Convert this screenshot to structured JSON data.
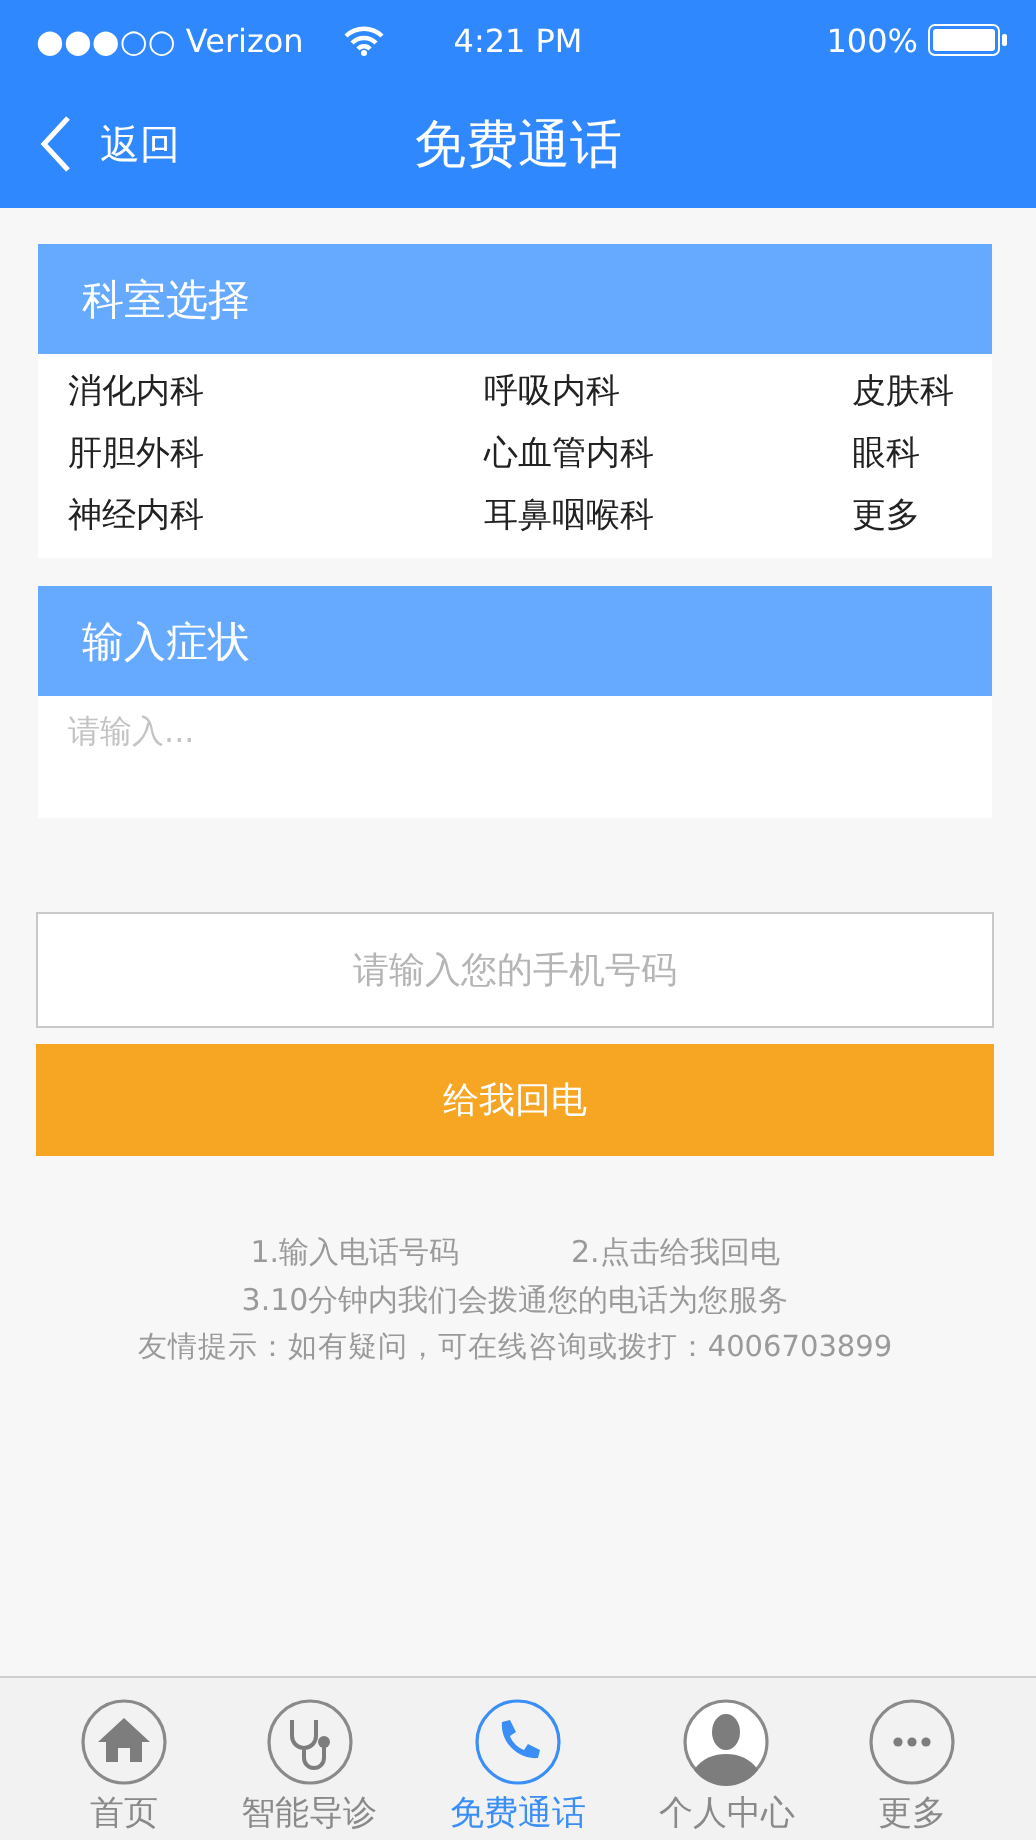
{
  "status_bar": {
    "carrier": "●●●○○ Verizon",
    "time": "4:21 PM",
    "battery": "100%"
  },
  "nav": {
    "back": "返回",
    "title": "免费通话"
  },
  "departments": {
    "title": "科室选择",
    "items": [
      "消化内科",
      "呼吸内科",
      "皮肤科",
      "肝胆外科",
      "心血管内科",
      "眼科",
      "神经内科",
      "耳鼻咽喉科",
      "更多"
    ]
  },
  "symptoms": {
    "title": "输入症状",
    "placeholder": "请输入..."
  },
  "phone": {
    "placeholder": "请输入您的手机号码"
  },
  "callback_button": "给我回电",
  "notes": {
    "step_1": "1.输入电话号码",
    "step_2": "2.点击给我回电",
    "step_3": "3.10分钟内我们会拨通您的电话为您服务",
    "tip": "友情提示：如有疑问，可在线咨询或拨打：4006703899"
  },
  "tabs": [
    {
      "label": "首页",
      "selected": false
    },
    {
      "label": "智能导诊",
      "selected": false
    },
    {
      "label": "免费通话",
      "selected": true
    },
    {
      "label": "个人中心",
      "selected": false
    },
    {
      "label": "更多",
      "selected": false
    }
  ]
}
